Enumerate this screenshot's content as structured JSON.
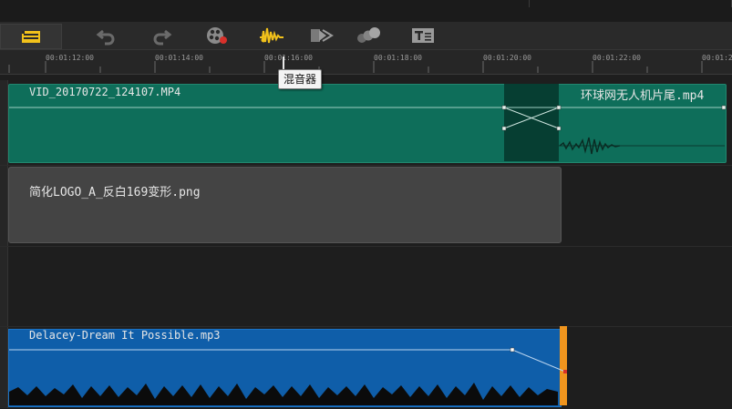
{
  "toolbar": {
    "buttons": [
      {
        "icon": "timeline-storyboard-icon",
        "name": "storyboard"
      },
      {
        "icon": "undo-icon",
        "name": "undo"
      },
      {
        "icon": "redo-icon",
        "name": "redo"
      },
      {
        "icon": "record-capture-icon",
        "name": "record"
      },
      {
        "icon": "audio-mixer-icon",
        "name": "mixer"
      },
      {
        "icon": "auto-music-icon",
        "name": "auto-music"
      },
      {
        "icon": "motion-tracking-icon",
        "name": "motion"
      },
      {
        "icon": "title-subtitle-icon",
        "name": "subtitle"
      }
    ],
    "tooltip": "混音器"
  },
  "ruler": {
    "labels": [
      "00:01:12:00",
      "00:01:14:00",
      "00:01:16:00",
      "00:01:18:00",
      "00:01:20:00",
      "00:01:22:00",
      "00:01:2"
    ]
  },
  "tracks": {
    "video_clip_1": "VID_20170722_124107.MP4",
    "video_clip_2": "环球网无人机片尾.mp4",
    "image_clip": "简化LOGO_A_反白169变形.png",
    "audio_clip": "Delacey-Dream It Possible.mp3"
  },
  "colors": {
    "video_clip": "#0e6e5a",
    "transition": "#063e32",
    "image_clip": "#444444",
    "audio_clip": "#0f5ea9",
    "audio_end_marker": "#f0951e",
    "active_icon": "#f2c21b"
  }
}
